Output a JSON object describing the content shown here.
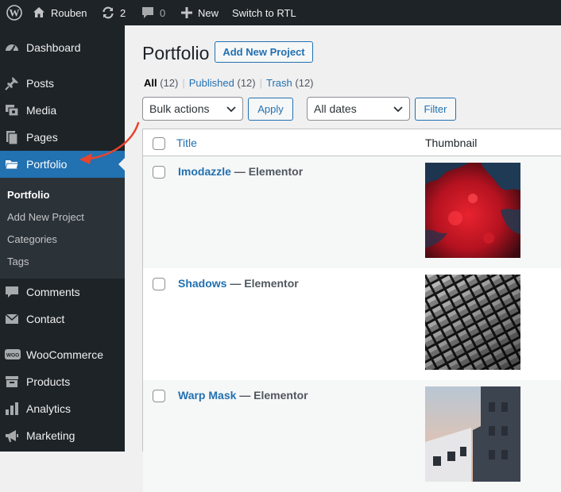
{
  "admin_bar": {
    "site_name": "Rouben",
    "updates_count": "2",
    "comments_count": "0",
    "new_label": "New",
    "rtl_label": "Switch to RTL"
  },
  "sidebar": {
    "items": [
      {
        "label": "Dashboard",
        "icon": "dashboard-icon"
      },
      {
        "label": "Posts",
        "icon": "pin-icon"
      },
      {
        "label": "Media",
        "icon": "media-icon"
      },
      {
        "label": "Pages",
        "icon": "pages-icon"
      },
      {
        "label": "Portfolio",
        "icon": "folder-icon",
        "active": true
      },
      {
        "label": "Comments",
        "icon": "comment-icon"
      },
      {
        "label": "Contact",
        "icon": "mail-icon"
      },
      {
        "label": "WooCommerce",
        "icon": "woo-icon"
      },
      {
        "label": "Products",
        "icon": "archive-icon"
      },
      {
        "label": "Analytics",
        "icon": "chart-icon"
      },
      {
        "label": "Marketing",
        "icon": "megaphone-icon"
      }
    ],
    "submenu": [
      "Portfolio",
      "Add New Project",
      "Categories",
      "Tags"
    ]
  },
  "main": {
    "title": "Portfolio",
    "add_new_label": "Add New Project",
    "filters": [
      {
        "label": "All",
        "count": "(12)"
      },
      {
        "label": "Published",
        "count": "(12)"
      },
      {
        "label": "Trash",
        "count": "(12)"
      }
    ],
    "bulk_actions": "Bulk actions",
    "apply_label": "Apply",
    "dates": "All dates",
    "filter_label": "Filter",
    "columns": {
      "title": "Title",
      "thumbnail": "Thumbnail"
    },
    "rows": [
      {
        "name": "Imodazzle",
        "sep": " — ",
        "state": "Elementor"
      },
      {
        "name": "Shadows",
        "sep": " — ",
        "state": "Elementor"
      },
      {
        "name": "Warp Mask",
        "sep": " — ",
        "state": "Elementor"
      }
    ]
  },
  "colors": {
    "admin_dark": "#1d2327",
    "submenu_bg": "#2c3338",
    "accent_blue": "#2271b1",
    "annotation_red": "#e8442c"
  }
}
